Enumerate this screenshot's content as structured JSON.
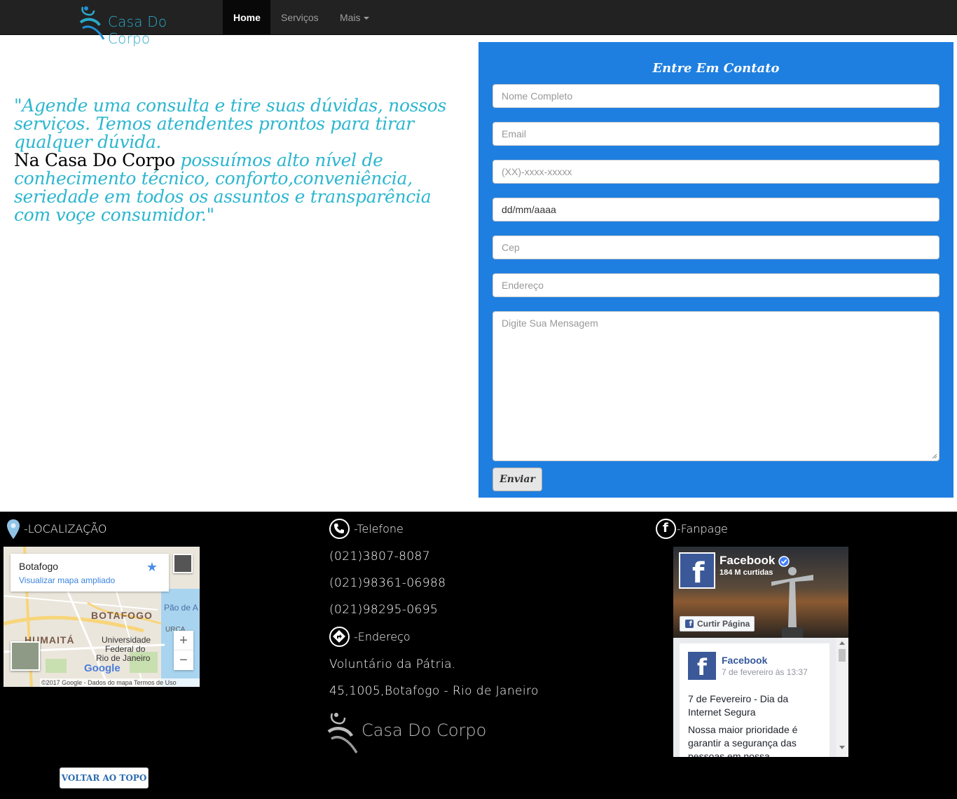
{
  "navbar": {
    "brand": "Casa Do Corpo",
    "items": [
      {
        "label": "Home",
        "active": true
      },
      {
        "label": "Serviços",
        "active": false
      },
      {
        "label": "Mais",
        "active": false
      }
    ]
  },
  "quote": {
    "part1": " \"Agende uma consulta e tire suas dúvidas, nossos serviços. Temos atendentes prontos para tirar qualquer dúvida.",
    "highlight": "Na Casa Do Corpo",
    "part2": " possuímos alto nível de conhecimento técnico, conforto,conveniência, seriedade em todos os assuntos e transparência com voçe consumidor.\""
  },
  "contact": {
    "title": "Entre Em Contato",
    "fields": {
      "name_placeholder": "Nome Completo",
      "email_placeholder": "Email",
      "phone_placeholder": "(XX)-xxxx-xxxxx",
      "date_value": "dd/mm/aaaa",
      "cep_placeholder": "Cep",
      "address_placeholder": "Endereço",
      "message_placeholder": "Digite Sua Mensagem"
    },
    "submit_label": "Enviar"
  },
  "footer": {
    "location_heading": "-LOCALIZAÇÃO",
    "phone_heading": "-Telefone",
    "phones": [
      "(021)3807-8087",
      "(021)98361-06988",
      "(021)98295-0695"
    ],
    "address_heading": "-Endereço",
    "address_lines": [
      "Voluntário da Pátria.",
      "45,1005,Botafogo - Rio de Janeiro"
    ],
    "brand": "Casa Do Corpo",
    "fanpage_heading": "-Fanpage",
    "back_to_top": "VOLTAR AO TOPO"
  },
  "map": {
    "place": "Botafogo",
    "link": "Visualizar mapa ampliado",
    "labels": {
      "botafogo": "BOTAFOGO",
      "humaita": "HUMAITÁ",
      "pao": "Pão de A",
      "urca": "URCA",
      "university": "Universidade",
      "federal": "Federal do",
      "rio": "Rio de Janeiro"
    },
    "google": "Google",
    "attribution": "©2017 Google - Dados do mapa     Termos de Uso",
    "zoom_in": "+",
    "zoom_out": "−"
  },
  "facebook": {
    "page_name": "Facebook",
    "likes": "184 M curtidas",
    "like_button": "Curtir Página",
    "post_author": "Facebook",
    "post_date": "7 de fevereiro às 13:37",
    "post_title": "7 de Fevereiro - Dia da Internet Segura",
    "post_body": "Nossa maior prioridade é garantir a segurança das pessoas em nossa"
  },
  "colors": {
    "navbar": "#222222",
    "accent_text": "#2cb6cf",
    "form_bg": "#1f7fe0",
    "footer_bg": "#000000",
    "fb_blue": "#3b5998"
  }
}
